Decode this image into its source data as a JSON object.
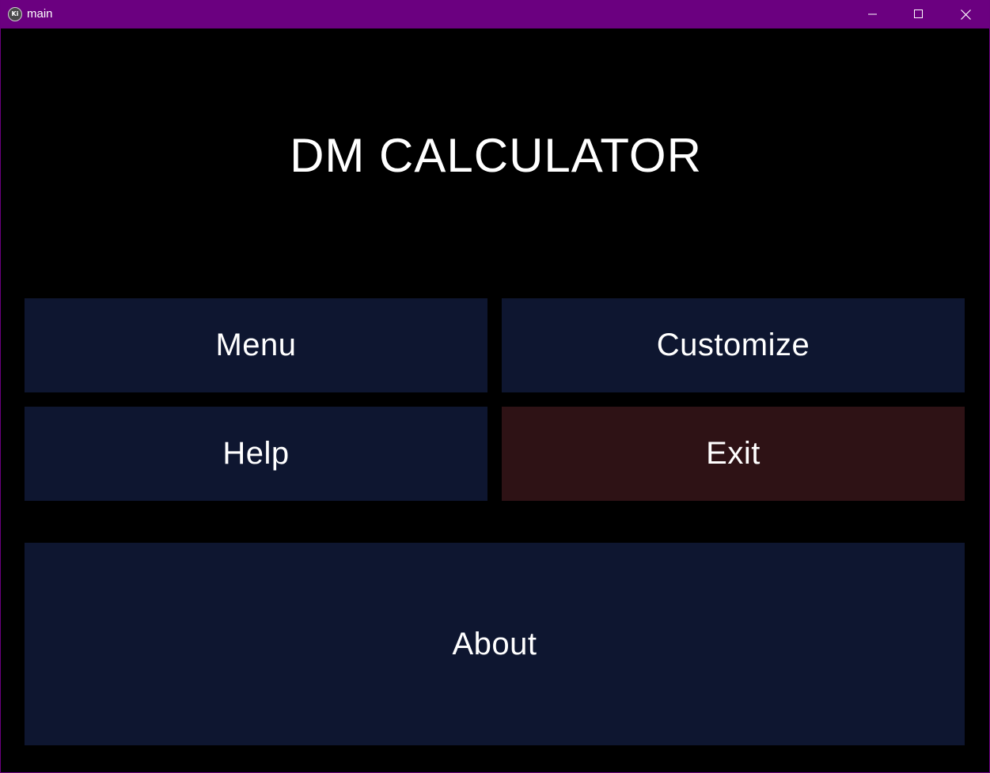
{
  "window": {
    "title": "main",
    "app_icon": "kivy-logo-icon",
    "app_icon_glyph": "Ki",
    "controls": {
      "minimize_icon": "minimize-icon",
      "maximize_icon": "maximize-icon",
      "close_icon": "close-icon"
    },
    "titlebar_color": "#6b0080"
  },
  "main": {
    "heading": "DM CALCULATOR",
    "buttons": {
      "menu": "Menu",
      "customize": "Customize",
      "help": "Help",
      "exit": "Exit",
      "about": "About"
    }
  },
  "colors": {
    "background": "#000000",
    "tile": "#0e1630",
    "exit_tile": "#2e1215",
    "text": "#ffffff"
  }
}
